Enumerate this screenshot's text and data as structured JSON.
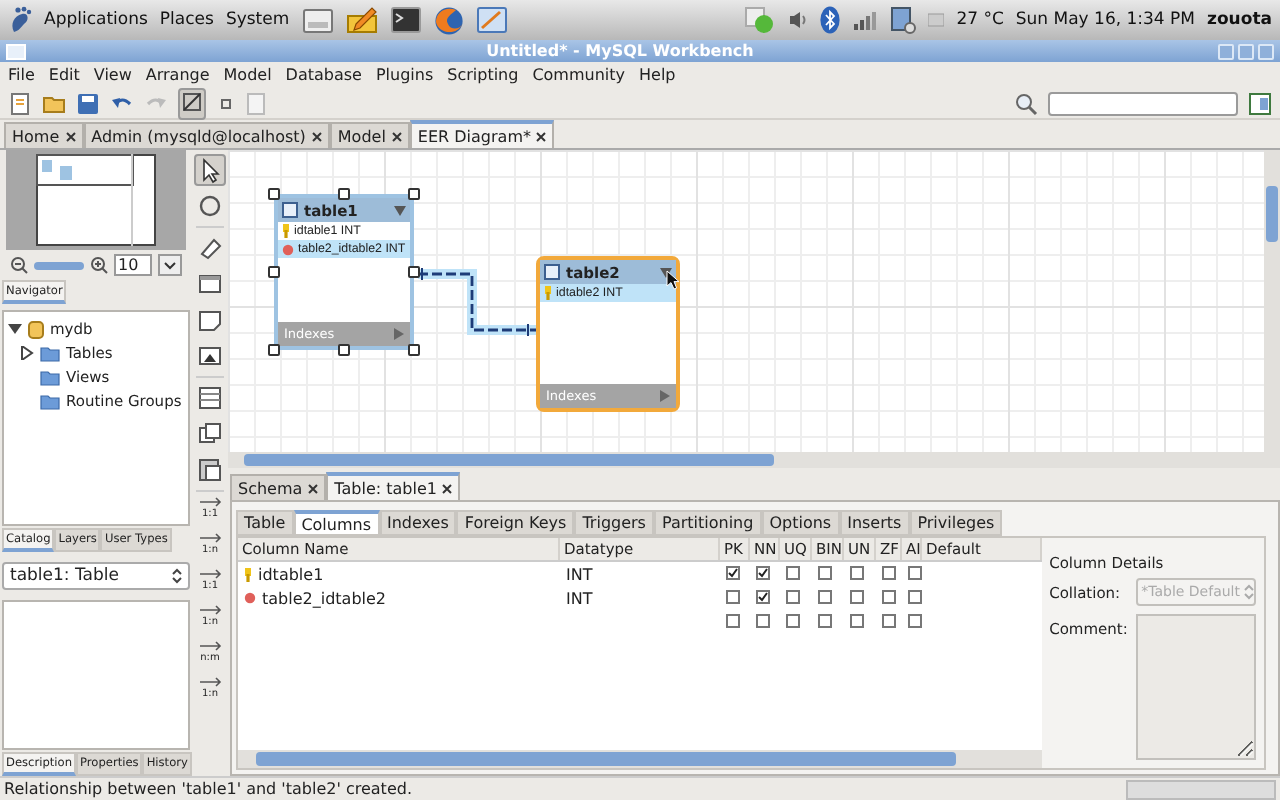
{
  "top_panel": {
    "menus": [
      "Applications",
      "Places",
      "System"
    ],
    "weather": "27 °C",
    "clock": "Sun May 16,  1:34 PM",
    "user": "zouota"
  },
  "window": {
    "title": "Untitled* - MySQL Workbench"
  },
  "menu_bar": [
    "File",
    "Edit",
    "View",
    "Arrange",
    "Model",
    "Database",
    "Plugins",
    "Scripting",
    "Community",
    "Help"
  ],
  "doc_tabs": [
    {
      "label": "Home",
      "selected": false
    },
    {
      "label": "Admin (mysqld@localhost)",
      "selected": false
    },
    {
      "label": "Model",
      "selected": false
    },
    {
      "label": "EER Diagram*",
      "selected": true
    }
  ],
  "navigator": {
    "zoom": "10",
    "tab": "Navigator"
  },
  "catalog_tree": [
    {
      "label": "mydb",
      "expanded": true,
      "children": [
        {
          "label": "Tables",
          "expanded": false
        },
        {
          "label": "Views"
        },
        {
          "label": "Routine Groups"
        }
      ]
    }
  ],
  "side_tabs": [
    {
      "label": "Catalog",
      "selected": true
    },
    {
      "label": "Layers",
      "selected": false
    },
    {
      "label": "User Types",
      "selected": false
    }
  ],
  "object_select": "table1: Table",
  "info_tabs": [
    {
      "label": "Description",
      "selected": true
    },
    {
      "label": "Properties",
      "selected": false
    },
    {
      "label": "History",
      "selected": false
    }
  ],
  "relationship_tools": [
    "1:1",
    "1:n",
    "1:1",
    "1:n",
    "n:m",
    "1:n"
  ],
  "diagram": {
    "tables": [
      {
        "name": "table1",
        "selected": true,
        "hovered": false,
        "footer": "Indexes",
        "columns": [
          {
            "text": "idtable1 INT",
            "kind": "primary",
            "highlighted": false
          },
          {
            "text": "table2_idtable2 INT",
            "kind": "foreign",
            "highlighted": true
          }
        ]
      },
      {
        "name": "table2",
        "selected": false,
        "hovered": true,
        "footer": "Indexes",
        "columns": [
          {
            "text": "idtable2 INT",
            "kind": "primary",
            "highlighted": true
          }
        ]
      }
    ]
  },
  "editor_tabs": [
    {
      "label": "Schema",
      "selected": false
    },
    {
      "label": "Table: table1",
      "selected": true
    }
  ],
  "inner_tabs": [
    {
      "label": "Table",
      "selected": false
    },
    {
      "label": "Columns",
      "selected": true
    },
    {
      "label": "Indexes",
      "selected": false
    },
    {
      "label": "Foreign Keys",
      "selected": false
    },
    {
      "label": "Triggers",
      "selected": false
    },
    {
      "label": "Partitioning",
      "selected": false
    },
    {
      "label": "Options",
      "selected": false
    },
    {
      "label": "Inserts",
      "selected": false
    },
    {
      "label": "Privileges",
      "selected": false
    }
  ],
  "columns_grid": {
    "headers": [
      "Column Name",
      "Datatype",
      "PK",
      "NN",
      "UQ",
      "BIN",
      "UN",
      "ZF",
      "AI",
      "Default"
    ],
    "rows": [
      {
        "name": "idtable1",
        "kind": "primary",
        "datatype": "INT",
        "flags": [
          {
            "checked": true
          },
          {
            "checked": true
          },
          {
            "checked": false
          },
          {
            "checked": false
          },
          {
            "checked": false
          },
          {
            "checked": false
          },
          {
            "checked": false
          }
        ]
      },
      {
        "name": "table2_idtable2",
        "kind": "foreign",
        "datatype": "INT",
        "flags": [
          {
            "checked": false
          },
          {
            "checked": true
          },
          {
            "checked": false
          },
          {
            "checked": false
          },
          {
            "checked": false
          },
          {
            "checked": false
          },
          {
            "checked": false
          }
        ]
      },
      {
        "flags": [
          {
            "checked": false
          },
          {
            "checked": false
          },
          {
            "checked": false
          },
          {
            "checked": false
          },
          {
            "checked": false
          },
          {
            "checked": false
          },
          {
            "checked": false
          }
        ]
      }
    ]
  },
  "column_details": {
    "title": "Column Details",
    "collation_label": "Collation:",
    "collation": "*Table Default",
    "comment_label": "Comment:"
  },
  "status_bar": "Relationship between 'table1' and 'table2' created."
}
